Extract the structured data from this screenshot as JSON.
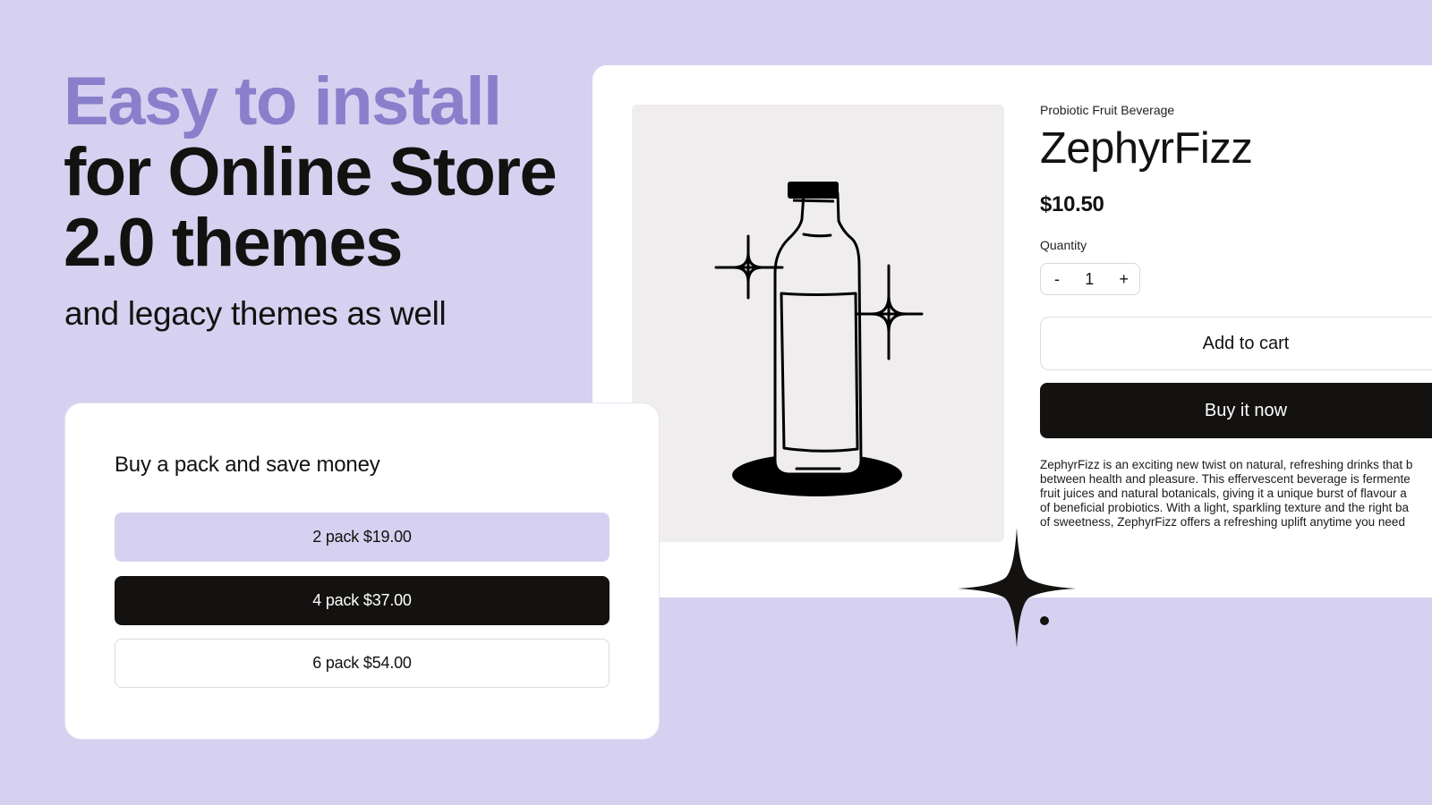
{
  "headline": {
    "line1": "Easy to install",
    "line2": "for Online Store",
    "line3": "2.0 themes",
    "subhead": "and legacy themes as well"
  },
  "colors": {
    "background": "#d6d1f0",
    "accent": "#8a7fcb",
    "dark": "#141210",
    "image_bg": "#efedee"
  },
  "product": {
    "eyebrow": "Probiotic Fruit Beverage",
    "title": "ZephyrFizz",
    "price": "$10.50",
    "quantity_label": "Quantity",
    "quantity": {
      "decrement": "-",
      "value": "1",
      "increment": "+"
    },
    "add_to_cart": "Add to cart",
    "buy_now": "Buy it now",
    "description_lines": [
      "ZephyrFizz is an exciting new twist on natural, refreshing drinks that b",
      "between health and pleasure. This effervescent beverage is fermente",
      "fruit juices and natural botanicals, giving it a unique burst of flavour a",
      "of beneficial probiotics. With a light, sparkling texture and the right ba",
      "of sweetness, ZephyrFizz offers a refreshing uplift anytime you need"
    ],
    "image_icon": "bottle-with-sparkles-icon"
  },
  "pack_offer": {
    "title": "Buy a pack and save money",
    "options": [
      {
        "label": "2 pack $19.00"
      },
      {
        "label": "4 pack $37.00"
      },
      {
        "label": "6 pack $54.00"
      }
    ]
  }
}
